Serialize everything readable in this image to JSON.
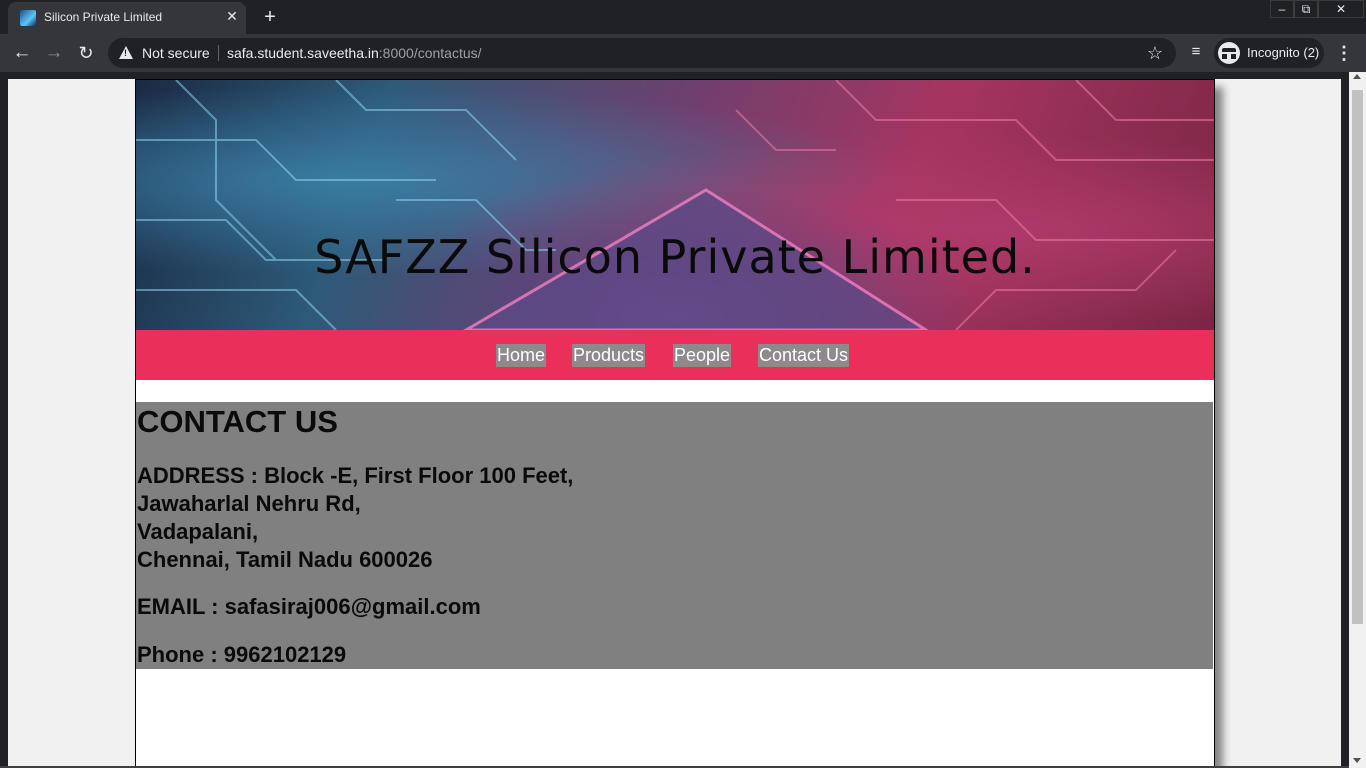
{
  "browser": {
    "tab_title": "Silicon Private Limited",
    "new_tab_symbol": "+",
    "close_symbol": "✕",
    "security_label": "Not secure",
    "url_host": "safa.student.saveetha.in",
    "url_rest": ":8000/contactus/",
    "profile_label": "Incognito (2)"
  },
  "site": {
    "banner_title": "SAFZZ Silicon Private Limited.",
    "nav": [
      {
        "label": "Home"
      },
      {
        "label": "Products"
      },
      {
        "label": "People"
      },
      {
        "label": "Contact Us"
      }
    ],
    "contact": {
      "heading": "CONTACT US",
      "address_lines": [
        "ADDRESS : Block -E, First Floor 100 Feet,",
        "Jawaharlal Nehru Rd,",
        "Vadapalani,",
        "Chennai, Tamil Nadu 600026"
      ],
      "email": "EMAIL : safasiraj006@gmail.com",
      "phone": "Phone : 9962102129"
    }
  },
  "colors": {
    "nav_bar": "#eb2f5b",
    "nav_item_bg": "#8d8a8b",
    "contact_bg": "#808080"
  },
  "icons": [
    "favicon-icon",
    "close-icon",
    "plus-icon",
    "back-arrow-icon",
    "forward-arrow-icon",
    "reload-icon",
    "warning-icon",
    "star-icon",
    "media-control-icon",
    "incognito-icon",
    "more-menu-icon"
  ]
}
